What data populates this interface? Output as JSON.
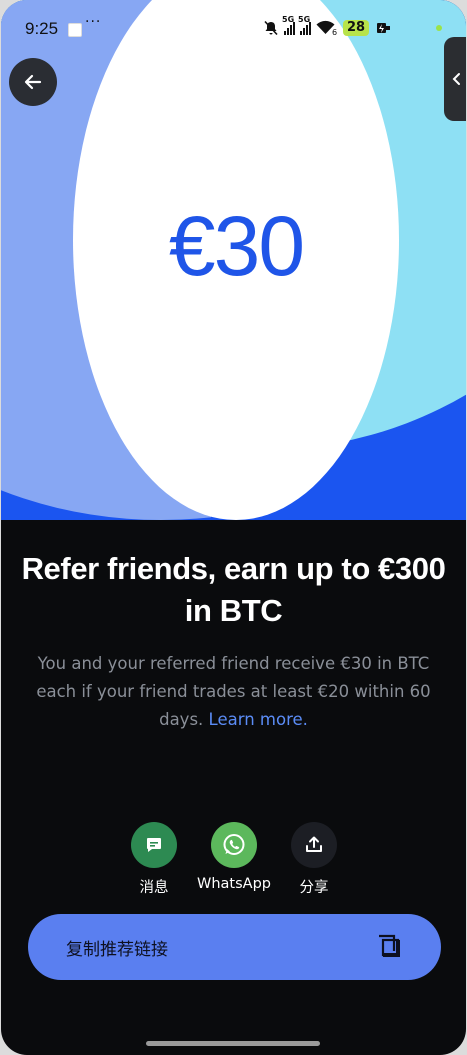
{
  "status_bar": {
    "time": "9:25",
    "overflow": "···",
    "net1": "5G",
    "net2": "5G",
    "wifi_sub": "6",
    "battery": "28"
  },
  "hero": {
    "amount": "€30"
  },
  "headline": "Refer friends, earn up to €300 in BTC",
  "description": {
    "text": "You and your referred friend receive €30 in BTC each if your friend trades at least €20 within 60 days.",
    "link": "Learn more."
  },
  "share_options": [
    {
      "label": "消息",
      "icon": "message-icon",
      "color": "#2d8a52"
    },
    {
      "label": "WhatsApp",
      "icon": "whatsapp-icon",
      "color": "#5cb85c"
    },
    {
      "label": "分享",
      "icon": "share-icon",
      "color": "#1c1e24"
    }
  ],
  "copy_button": {
    "label": "复制推荐链接",
    "icon": "copy-icon"
  },
  "colors": {
    "accent": "#1f55e8",
    "button": "#5a7ff0",
    "background": "#0a0b0d",
    "link": "#5b8cf6"
  }
}
